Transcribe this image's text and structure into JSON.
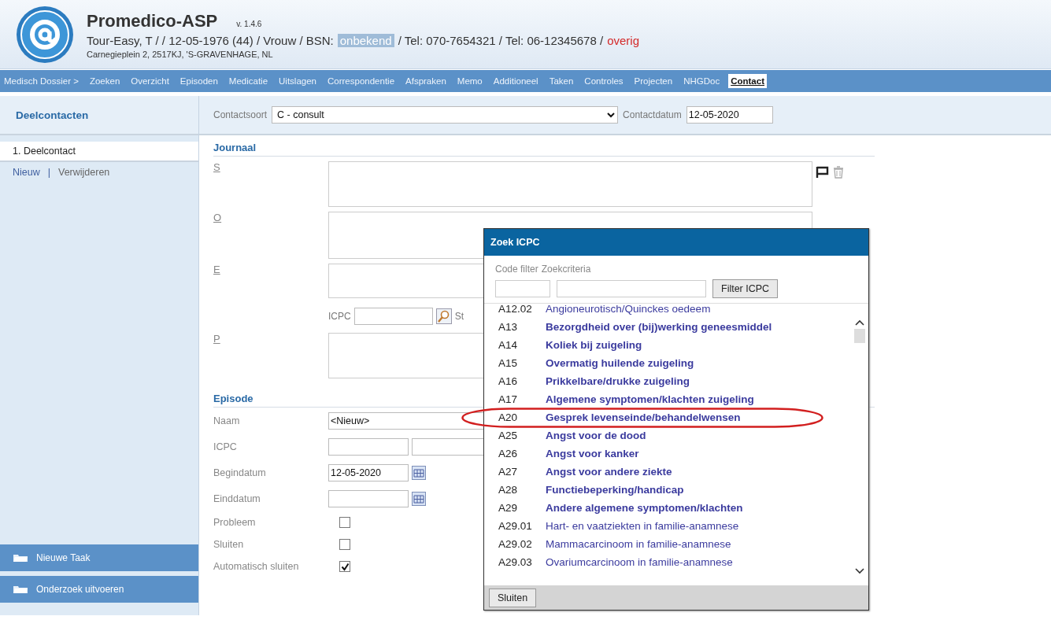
{
  "app": {
    "title": "Promedico-ASP",
    "version": "v. 1.4.6"
  },
  "patient": {
    "summary": "Tour-Easy, T / / 12-05-1976 (44) / Vrouw / BSN:",
    "bsn": "onbekend",
    "phones": "/ Tel: 070-7654321 / Tel: 06-12345678 /",
    "category": "overig",
    "address": "Carnegieplein 2, 2517KJ, 'S-GRAVENHAGE, NL"
  },
  "nav": [
    {
      "label": "Medisch Dossier >",
      "selected": false
    },
    {
      "label": "Zoeken",
      "selected": false
    },
    {
      "label": "Overzicht",
      "selected": false
    },
    {
      "label": "Episoden",
      "selected": false
    },
    {
      "label": "Medicatie",
      "selected": false
    },
    {
      "label": "Uitslagen",
      "selected": false
    },
    {
      "label": "Correspondentie",
      "selected": false
    },
    {
      "label": "Afspraken",
      "selected": false
    },
    {
      "label": "Memo",
      "selected": false
    },
    {
      "label": "Additioneel",
      "selected": false
    },
    {
      "label": "Taken",
      "selected": false
    },
    {
      "label": "Controles",
      "selected": false
    },
    {
      "label": "Projecten",
      "selected": false
    },
    {
      "label": "NHGDoc",
      "selected": false
    },
    {
      "label": "Contact",
      "selected": true
    }
  ],
  "sidebar": {
    "title": "Deelcontacten",
    "items": [
      {
        "label": "1. Deelcontact",
        "selected": true
      }
    ],
    "links": [
      "Nieuw",
      "Verwijderen"
    ],
    "separator": "|",
    "actions": [
      "Nieuwe Taak",
      "Onderzoek uitvoeren"
    ]
  },
  "contact": {
    "type_label": "Contactsoort",
    "type_value": "C - consult",
    "date_label": "Contactdatum",
    "date_value": "12-05-2020"
  },
  "journal": {
    "title": "Journaal",
    "fields": [
      {
        "label": "S"
      },
      {
        "label": "O"
      },
      {
        "label": "E"
      },
      {
        "label": "P"
      }
    ],
    "icpc_label": "ICPC",
    "icpc_suffix": "St"
  },
  "episode": {
    "title": "Episode",
    "rows": [
      {
        "kind": "text",
        "label": "Naam",
        "value": "<Nieuw>"
      },
      {
        "kind": "pair",
        "label": "ICPC"
      },
      {
        "kind": "date",
        "label": "Begindatum",
        "value": "12-05-2020"
      },
      {
        "kind": "date",
        "label": "Einddatum"
      },
      {
        "kind": "check",
        "label": "Probleem",
        "checked": false
      },
      {
        "kind": "check",
        "label": "Sluiten",
        "checked": false
      },
      {
        "kind": "check",
        "label": "Automatisch sluiten",
        "checked": true
      }
    ]
  },
  "dialog": {
    "title": "Zoek ICPC",
    "filter_labels": [
      "Code filter",
      "Zoekcriteria"
    ],
    "filter_button": "Filter ICPC",
    "close_button": "Sluiten",
    "rows": [
      {
        "code": "A12.02",
        "name": "Angioneurotisch/Quinckes oedeem",
        "kind": "subcode",
        "circled": false
      },
      {
        "code": "A13",
        "name": "Bezorgdheid over (bij)werking geneesmiddel",
        "kind": "code",
        "circled": false
      },
      {
        "code": "A14",
        "name": "Koliek bij zuigeling",
        "kind": "code",
        "circled": false
      },
      {
        "code": "A15",
        "name": "Overmatig huilende zuigeling",
        "kind": "code",
        "circled": false
      },
      {
        "code": "A16",
        "name": "Prikkelbare/drukke zuigeling",
        "kind": "code",
        "circled": false
      },
      {
        "code": "A17",
        "name": "Algemene symptomen/klachten zuigeling",
        "kind": "code",
        "circled": false
      },
      {
        "code": "A20",
        "name": "Gesprek levenseinde/behandelwensen",
        "kind": "code",
        "circled": true
      },
      {
        "code": "A25",
        "name": "Angst voor de dood",
        "kind": "code",
        "circled": false
      },
      {
        "code": "A26",
        "name": "Angst voor kanker",
        "kind": "code",
        "circled": false
      },
      {
        "code": "A27",
        "name": "Angst voor andere ziekte",
        "kind": "code",
        "circled": false
      },
      {
        "code": "A28",
        "name": "Functiebeperking/handicap",
        "kind": "code",
        "circled": false
      },
      {
        "code": "A29",
        "name": "Andere algemene symptomen/klachten",
        "kind": "code",
        "circled": false
      },
      {
        "code": "A29.01",
        "name": "Hart- en vaatziekten in familie-anamnese",
        "kind": "subcode",
        "circled": false
      },
      {
        "code": "A29.02",
        "name": "Mammacarcinoom in familie-anamnese",
        "kind": "subcode",
        "circled": false
      },
      {
        "code": "A29.03",
        "name": "Ovariumcarcinoom in familie-anamnese",
        "kind": "subcode",
        "circled": false
      }
    ]
  }
}
